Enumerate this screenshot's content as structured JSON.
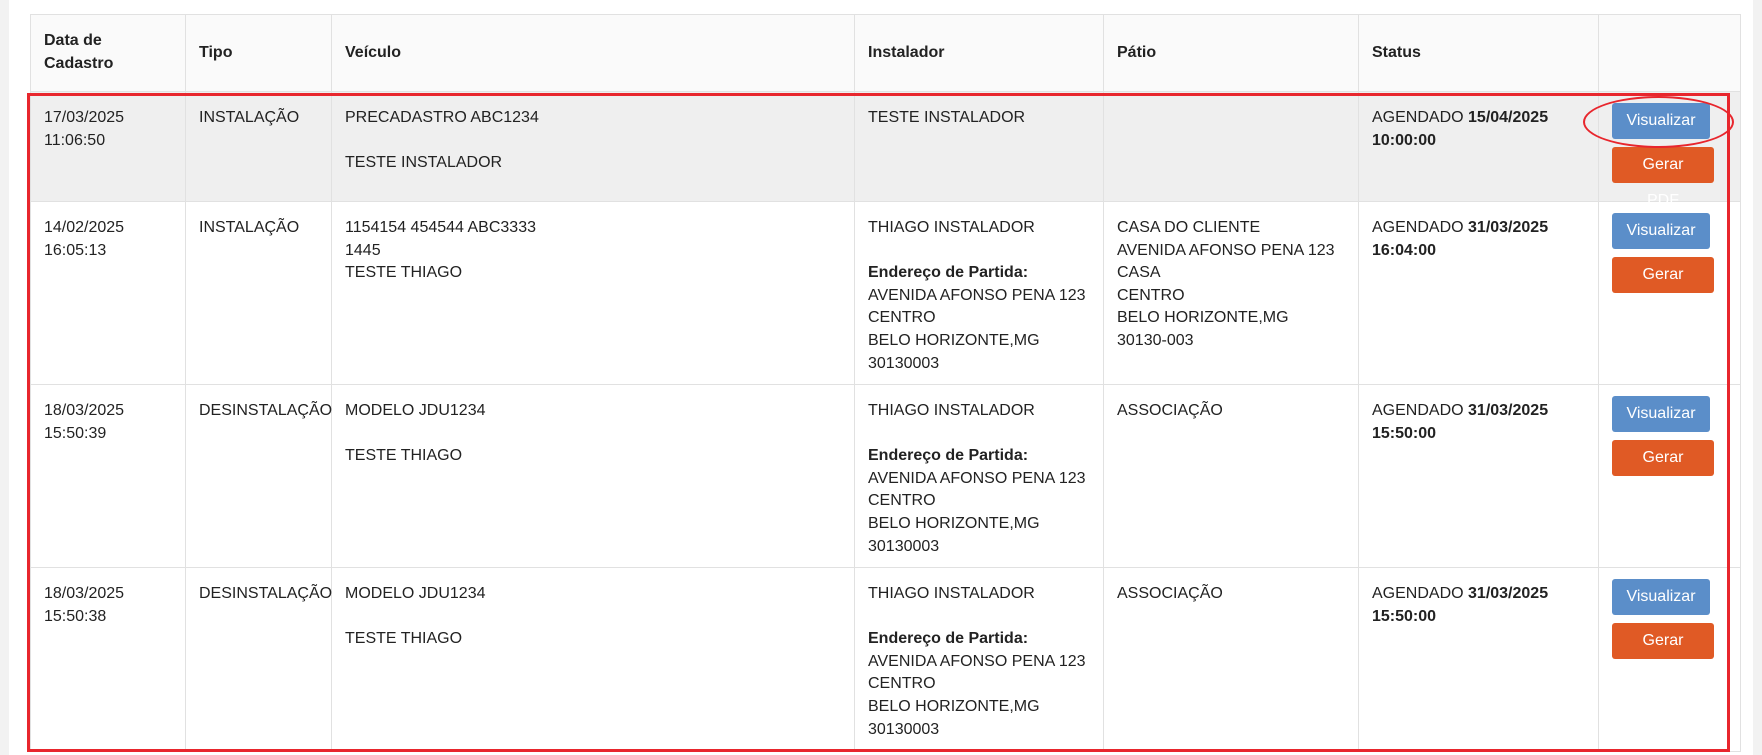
{
  "columns": [
    "Data de Cadastro",
    "Tipo",
    "Veículo",
    "Instalador",
    "Pátio",
    "Status",
    ""
  ],
  "rows": [
    {
      "date": "17/03/2025",
      "time": "11:06:50",
      "tipo": "INSTALAÇÃO",
      "veiculo_l1": "PRECADASTRO ABC1234",
      "veiculo_l2": "",
      "veiculo_l3": "TESTE INSTALADOR",
      "instalador": "TESTE INSTALADOR",
      "partida_label": "",
      "partida_l1": "",
      "partida_l2": "",
      "partida_l3": "",
      "partida_l4": "",
      "patio_l1": "",
      "patio_l2": "",
      "patio_l3": "",
      "patio_l4": "",
      "patio_l5": "",
      "patio_l6": "",
      "status_text": "AGENDADO ",
      "status_date": "15/04/2025",
      "status_time": "10:00:00",
      "view_label": "Visualizar",
      "pdf_label": "Gerar PDF"
    },
    {
      "date": "14/02/2025",
      "time": "16:05:13",
      "tipo": "INSTALAÇÃO",
      "veiculo_l1": "1154154 454544 ABC3333",
      "veiculo_l2": "1445",
      "veiculo_l3": "TESTE THIAGO",
      "instalador": "THIAGO INSTALADOR",
      "partida_label": "Endereço de Partida:",
      "partida_l1": "AVENIDA AFONSO PENA 123",
      "partida_l2": "CENTRO",
      "partida_l3": "BELO HORIZONTE,MG",
      "partida_l4": "30130003",
      "patio_l1": "CASA DO CLIENTE",
      "patio_l2": "AVENIDA AFONSO PENA 123",
      "patio_l3": "CASA",
      "patio_l4": "CENTRO",
      "patio_l5": "BELO HORIZONTE,MG",
      "patio_l6": "30130-003",
      "status_text": "AGENDADO ",
      "status_date": "31/03/2025",
      "status_time": "16:04:00",
      "view_label": "Visualizar",
      "pdf_label": "Gerar PDF"
    },
    {
      "date": "18/03/2025",
      "time": "15:50:39",
      "tipo": "DESINSTALAÇÃO",
      "veiculo_l1": "MODELO JDU1234",
      "veiculo_l2": "",
      "veiculo_l3": "TESTE THIAGO",
      "instalador": "THIAGO INSTALADOR",
      "partida_label": "Endereço de Partida:",
      "partida_l1": "AVENIDA AFONSO PENA 123",
      "partida_l2": "CENTRO",
      "partida_l3": "BELO HORIZONTE,MG",
      "partida_l4": "30130003",
      "patio_l1": "ASSOCIAÇÃO",
      "patio_l2": "",
      "patio_l3": "",
      "patio_l4": "",
      "patio_l5": "",
      "patio_l6": "",
      "status_text": "AGENDADO ",
      "status_date": "31/03/2025",
      "status_time": "15:50:00",
      "view_label": "Visualizar",
      "pdf_label": "Gerar PDF"
    },
    {
      "date": "18/03/2025",
      "time": "15:50:38",
      "tipo": "DESINSTALAÇÃO",
      "veiculo_l1": "MODELO JDU1234",
      "veiculo_l2": "",
      "veiculo_l3": "TESTE THIAGO",
      "instalador": "THIAGO INSTALADOR",
      "partida_label": "Endereço de Partida:",
      "partida_l1": "AVENIDA AFONSO PENA 123",
      "partida_l2": "CENTRO",
      "partida_l3": "BELO HORIZONTE,MG",
      "partida_l4": "30130003",
      "patio_l1": "ASSOCIAÇÃO",
      "patio_l2": "",
      "patio_l3": "",
      "patio_l4": "",
      "patio_l5": "",
      "patio_l6": "",
      "status_text": "AGENDADO ",
      "status_date": "31/03/2025",
      "status_time": "15:50:00",
      "view_label": "Visualizar",
      "pdf_label": "Gerar PDF"
    }
  ],
  "colors": {
    "view_button": "#5b8ec9",
    "pdf_button": "#e05a25",
    "annotation": "#e8262d",
    "selected_row": "#efefef"
  }
}
